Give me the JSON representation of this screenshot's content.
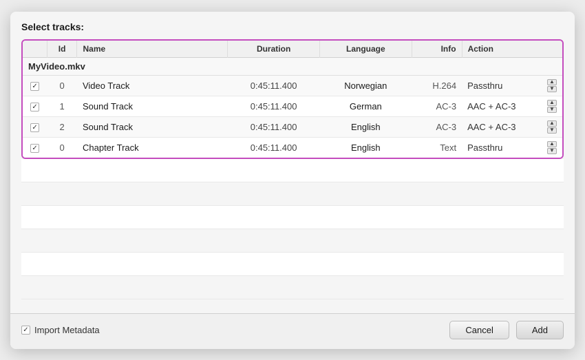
{
  "dialog": {
    "title": "Select tracks:",
    "table": {
      "columns": {
        "check": "",
        "id": "Id",
        "name": "Name",
        "duration": "Duration",
        "language": "Language",
        "info": "Info",
        "action": "Action"
      },
      "filename": "MyVideo.mkv",
      "rows": [
        {
          "checked": true,
          "id": "0",
          "name": "Video Track",
          "duration": "0:45:11.400",
          "language": "Norwegian",
          "info": "H.264",
          "action": "Passthru"
        },
        {
          "checked": true,
          "id": "1",
          "name": "Sound Track",
          "duration": "0:45:11.400",
          "language": "German",
          "info": "AC-3",
          "action": "AAC + AC-3"
        },
        {
          "checked": true,
          "id": "2",
          "name": "Sound Track",
          "duration": "0:45:11.400",
          "language": "English",
          "info": "AC-3",
          "action": "AAC + AC-3"
        },
        {
          "checked": true,
          "id": "0",
          "name": "Chapter Track",
          "duration": "0:45:11.400",
          "language": "English",
          "info": "Text",
          "action": "Passthru"
        }
      ]
    },
    "footer": {
      "import_metadata_label": "Import Metadata",
      "cancel_label": "Cancel",
      "add_label": "Add"
    }
  }
}
